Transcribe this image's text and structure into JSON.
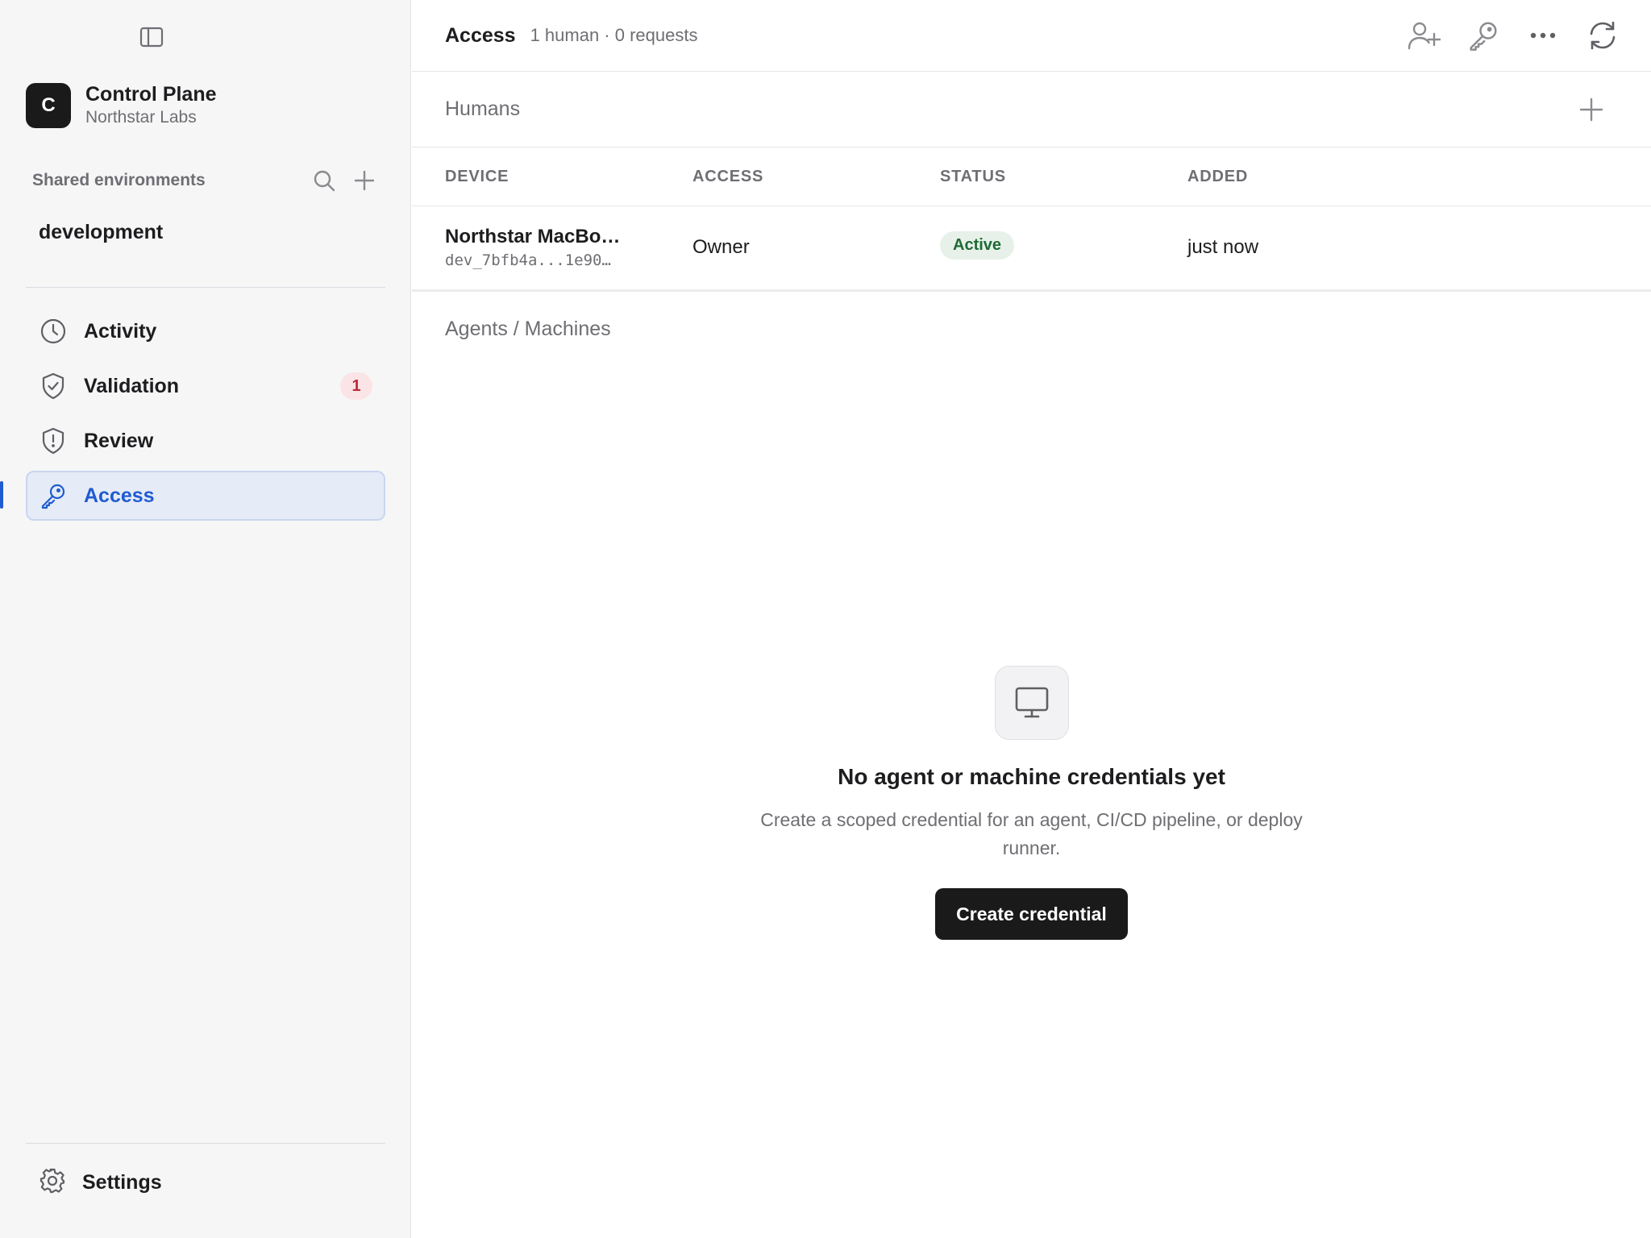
{
  "sidebar": {
    "brand": {
      "initial": "C",
      "name": "Control Plane",
      "org": "Northstar Labs"
    },
    "section_label": "Shared environments",
    "environments": [
      "development"
    ],
    "nav": [
      {
        "label": "Activity",
        "icon": "clock-icon",
        "badge": null,
        "active": false
      },
      {
        "label": "Validation",
        "icon": "shield-check-icon",
        "badge": "1",
        "active": false
      },
      {
        "label": "Review",
        "icon": "shield-alert-icon",
        "badge": null,
        "active": false
      },
      {
        "label": "Access",
        "icon": "key-icon",
        "badge": null,
        "active": true
      }
    ],
    "settings_label": "Settings"
  },
  "header": {
    "title": "Access",
    "meta": "1 human · 0 requests",
    "actions": [
      "add-user-icon",
      "key-icon",
      "more-icon",
      "refresh-icon"
    ]
  },
  "humans": {
    "title": "Humans",
    "columns": [
      "DEVICE",
      "ACCESS",
      "STATUS",
      "ADDED"
    ],
    "rows": [
      {
        "device_name": "Northstar MacBo…",
        "device_id": "dev_7bfb4a...1e90…",
        "access": "Owner",
        "status": "Active",
        "added": "just now"
      }
    ]
  },
  "agents": {
    "title": "Agents / Machines",
    "empty_title": "No agent or machine credentials yet",
    "empty_desc": "Create a scoped credential for an agent, CI/CD pipeline, or deploy runner.",
    "cta_label": "Create credential",
    "empty_icon": "monitor-icon"
  },
  "colors": {
    "accent": "#1f5bd1",
    "badge_bg": "#fbe4e6",
    "badge_fg": "#c0293b",
    "status_bg": "#e7f1e9",
    "status_fg": "#1e6b34",
    "cta_bg": "#1a1a1a"
  }
}
